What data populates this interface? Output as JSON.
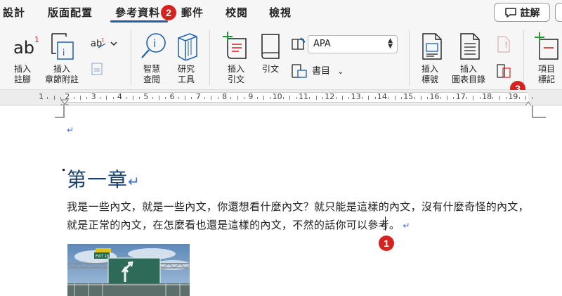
{
  "tabs": [
    {
      "label": "設計"
    },
    {
      "label": "版面配置"
    },
    {
      "label": "參考資料"
    },
    {
      "label": "郵件"
    },
    {
      "label": "校閱"
    },
    {
      "label": "檢視"
    }
  ],
  "comment_button": {
    "label": "註解"
  },
  "ribbon": {
    "insert_footnote": "插入\n註腳",
    "insert_endnote": "插入\n章節附註",
    "smart_lookup": "智慧\n查閱",
    "researcher": "研究\n工具",
    "insert_citation": "插入\n引文",
    "citations": "引文",
    "style_value": "APA",
    "bibliography": "書目",
    "insert_caption": "插入\n標號",
    "insert_table_of_figures": "插入\n圖表目錄",
    "mark_entry": "項目\n標記"
  },
  "ruler": {
    "numbers": [
      "1",
      "2",
      "3",
      "4",
      "5",
      "6",
      "7",
      "8",
      "9",
      "10",
      "11",
      "12",
      "13",
      "14",
      "15",
      "16",
      "17",
      "18",
      "19"
    ]
  },
  "document": {
    "heading": "第一章",
    "line1": "我是一些內文，就是一些內文，你還想看什麼內文？就只能是這樣的內文，沒有什麼奇怪的內文，",
    "line2": "就是正常的內文，在怎麼看也還是這樣的內文，不然的話你可以參考",
    "line2_tail": "。",
    "paragraph_mark": "↵",
    "sign_text": "EXIT 18"
  },
  "badges": {
    "b1": "1",
    "b2": "2",
    "b3": "3"
  },
  "colors": {
    "accent": "#1c5fb0",
    "heading": "#17406d",
    "badge": "#d42420",
    "paragraph_mark": "#3b6fd1"
  }
}
